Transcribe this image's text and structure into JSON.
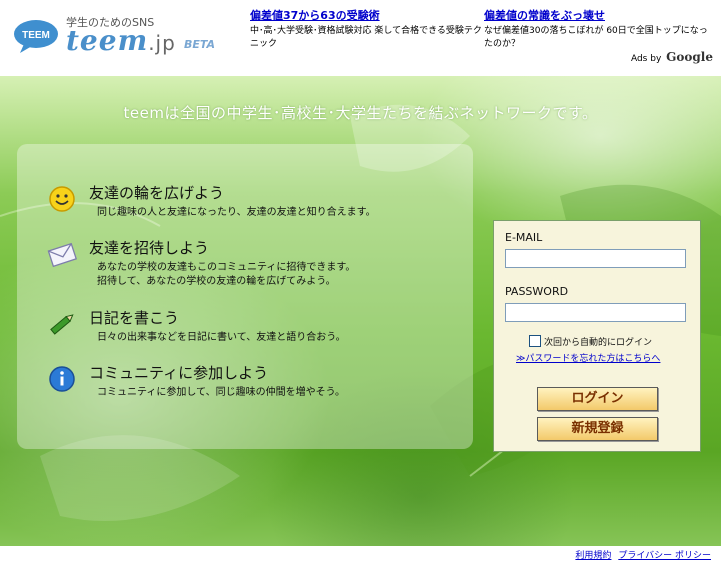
{
  "header": {
    "logo": {
      "tagline": "学生のためのSNS",
      "word": "teem",
      "domain": ".jp",
      "badge": "BETA",
      "bubble_text": "TEEM"
    },
    "ads": [
      {
        "title": "偏差値37から63の受験術",
        "text": "中･高･大学受験･資格試験対応 楽して合格できる受験テクニック"
      },
      {
        "title": "偏差値の常識をぶっ壊せ",
        "text": "なぜ偏差値30の落ちこぼれが 60日で全国トップになったのか？"
      }
    ],
    "ads_by": "Ads by",
    "ads_brand": "Google"
  },
  "hero": {
    "tagline": "teemは全国の中学生･高校生･大学生たちを結ぶネットワークです。"
  },
  "features": [
    {
      "icon": "smiley-icon",
      "title": "友達の輪を広げよう",
      "desc": "同じ趣味の人と友達になったり、友達の友達と知り合えます。"
    },
    {
      "icon": "envelope-icon",
      "title": "友達を招待しよう",
      "desc": "あなたの学校の友達もこのコミュニティに招待できます。\n招待して、あなたの学校の友達の輪を広げてみよう。"
    },
    {
      "icon": "pencil-icon",
      "title": "日記を書こう",
      "desc": "日々の出来事などを日記に書いて、友達と語り合おう。"
    },
    {
      "icon": "info-icon",
      "title": "コミュニティに参加しよう",
      "desc": "コミュニティに参加して、同じ趣味の仲間を増やそう。"
    }
  ],
  "login": {
    "email_label": "E-MAIL",
    "email_value": "",
    "password_label": "PASSWORD",
    "password_value": "",
    "auto_login_label": "次回から自動的にログイン",
    "auto_login_checked": false,
    "forgot_link": "≫パスワードを忘れた方はこちらへ",
    "login_button": "ログイン",
    "register_button": "新規登録"
  },
  "footer": {
    "links": [
      "利用規約",
      "プライバシー ポリシー"
    ]
  },
  "colors": {
    "link": "#0000cc",
    "button_text": "#7a3000",
    "login_bg": "#f7f4dc",
    "hero_green": "#6ab830"
  }
}
